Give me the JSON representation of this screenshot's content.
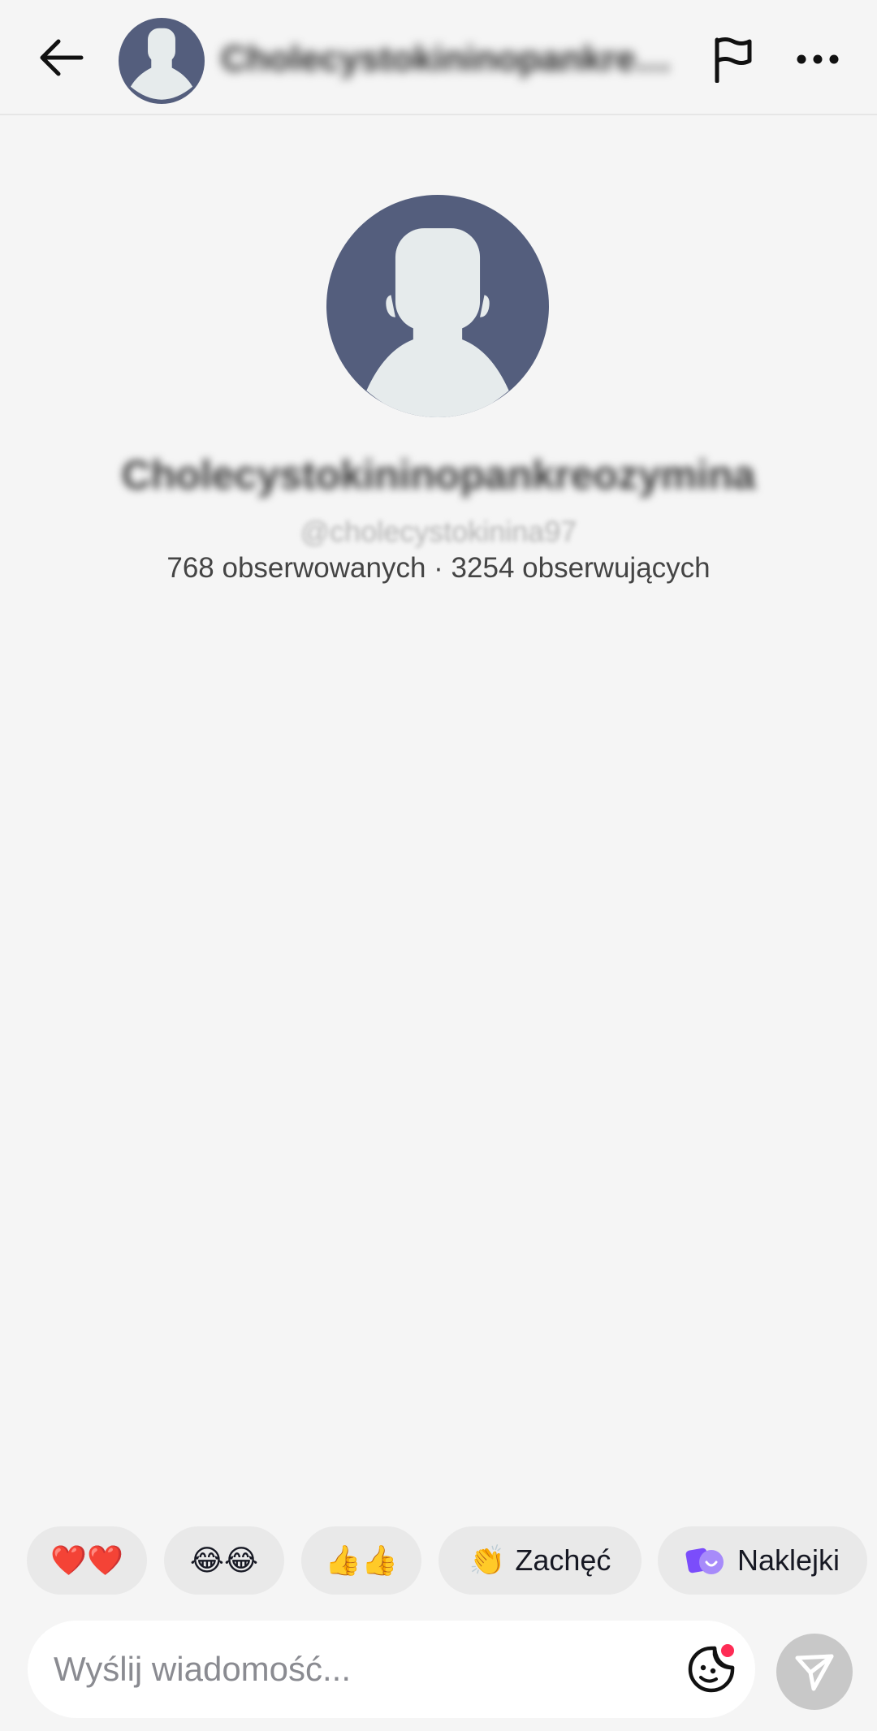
{
  "header": {
    "name": "Cholecystokininopankreo..."
  },
  "profile": {
    "name": "Cholecystokininopankreozymina",
    "handle": "@cholecystokinina97",
    "stats": "768 obserwowanych · 3254 obserwujących"
  },
  "reactions": {
    "hearts": "❤️❤️",
    "laughs": "😂😂",
    "thumbs": "👍👍",
    "encourage_emoji": "👏",
    "encourage_label": "Zachęć",
    "stickers_label": "Naklejki"
  },
  "composer": {
    "placeholder": "Wyślij wiadomość..."
  },
  "colors": {
    "avatar_bg": "#545e7d",
    "avatar_fg": "#e6ebec",
    "chip_bg": "#e9e9e9",
    "send_bg": "#c8c8c8",
    "notif_dot": "#fe2c55",
    "sticker_purple": "#8b5cf6"
  },
  "icons": {
    "back": "arrow-left-icon",
    "flag": "flag-icon",
    "more": "more-dots-icon",
    "sticker": "sticker-smile-icon",
    "send": "send-arrow-icon"
  }
}
